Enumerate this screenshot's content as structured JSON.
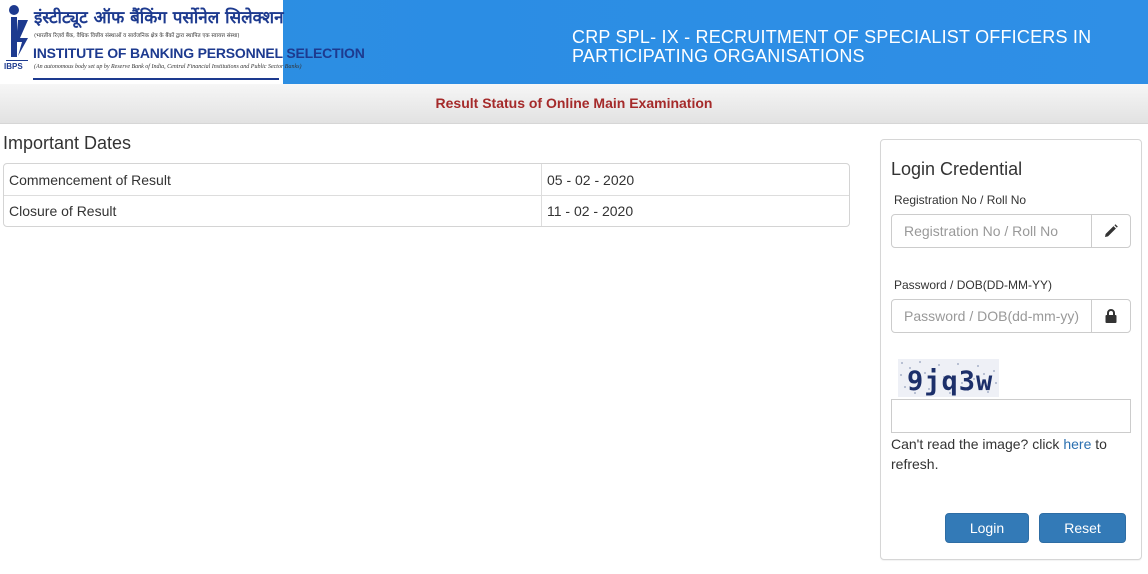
{
  "header": {
    "logo": {
      "hindi_name": "इंस्टीट्यूट ऑफ बैंकिंग पर्सोनेल सिलेक्शन",
      "hindi_tagline": "(भारतीय रिज़र्व बैंक, वैधिक वित्तीय संस्थाओं व सार्वजनिक क्षेत्र के बैंकों द्वारा स्थापित एक स्वायत्त संस्था)",
      "english_name": "INSTITUTE OF BANKING PERSONNEL SELECTION",
      "english_tagline": "(An autonomous body set up by Reserve Bank of India, Central Financial Institutions and Public Sector Banks)",
      "mark_label": "IBPS"
    },
    "title": "CRP SPL- IX - RECRUITMENT OF SPECIALIST OFFICERS IN PARTICIPATING ORGANISATIONS"
  },
  "subbar": {
    "title": "Result Status of Online Main Examination"
  },
  "important_dates": {
    "heading": "Important Dates",
    "rows": [
      {
        "label": "Commencement of Result",
        "value": "05 - 02 - 2020"
      },
      {
        "label": "Closure of Result",
        "value": "11 - 02 - 2020"
      }
    ]
  },
  "login": {
    "title": "Login Credential",
    "registration_label": "Registration No / Roll No",
    "registration_placeholder": "Registration No / Roll No",
    "password_label": "Password / DOB(DD-MM-YY)",
    "password_placeholder": "Password / DOB(dd-mm-yy)",
    "captcha_text": "9jq3w",
    "captcha_value": "",
    "refresh_prefix": "Can't read the image? click ",
    "refresh_link": "here",
    "refresh_suffix": " to refresh.",
    "login_button": "Login",
    "reset_button": "Reset"
  },
  "icons": {
    "registration_addon": "pencil-icon",
    "password_addon": "lock-icon"
  },
  "colors": {
    "header_blue": "#2b8de4",
    "subbar_title": "#a52a2a",
    "button": "#337ab7",
    "link": "#2a6fb0"
  }
}
